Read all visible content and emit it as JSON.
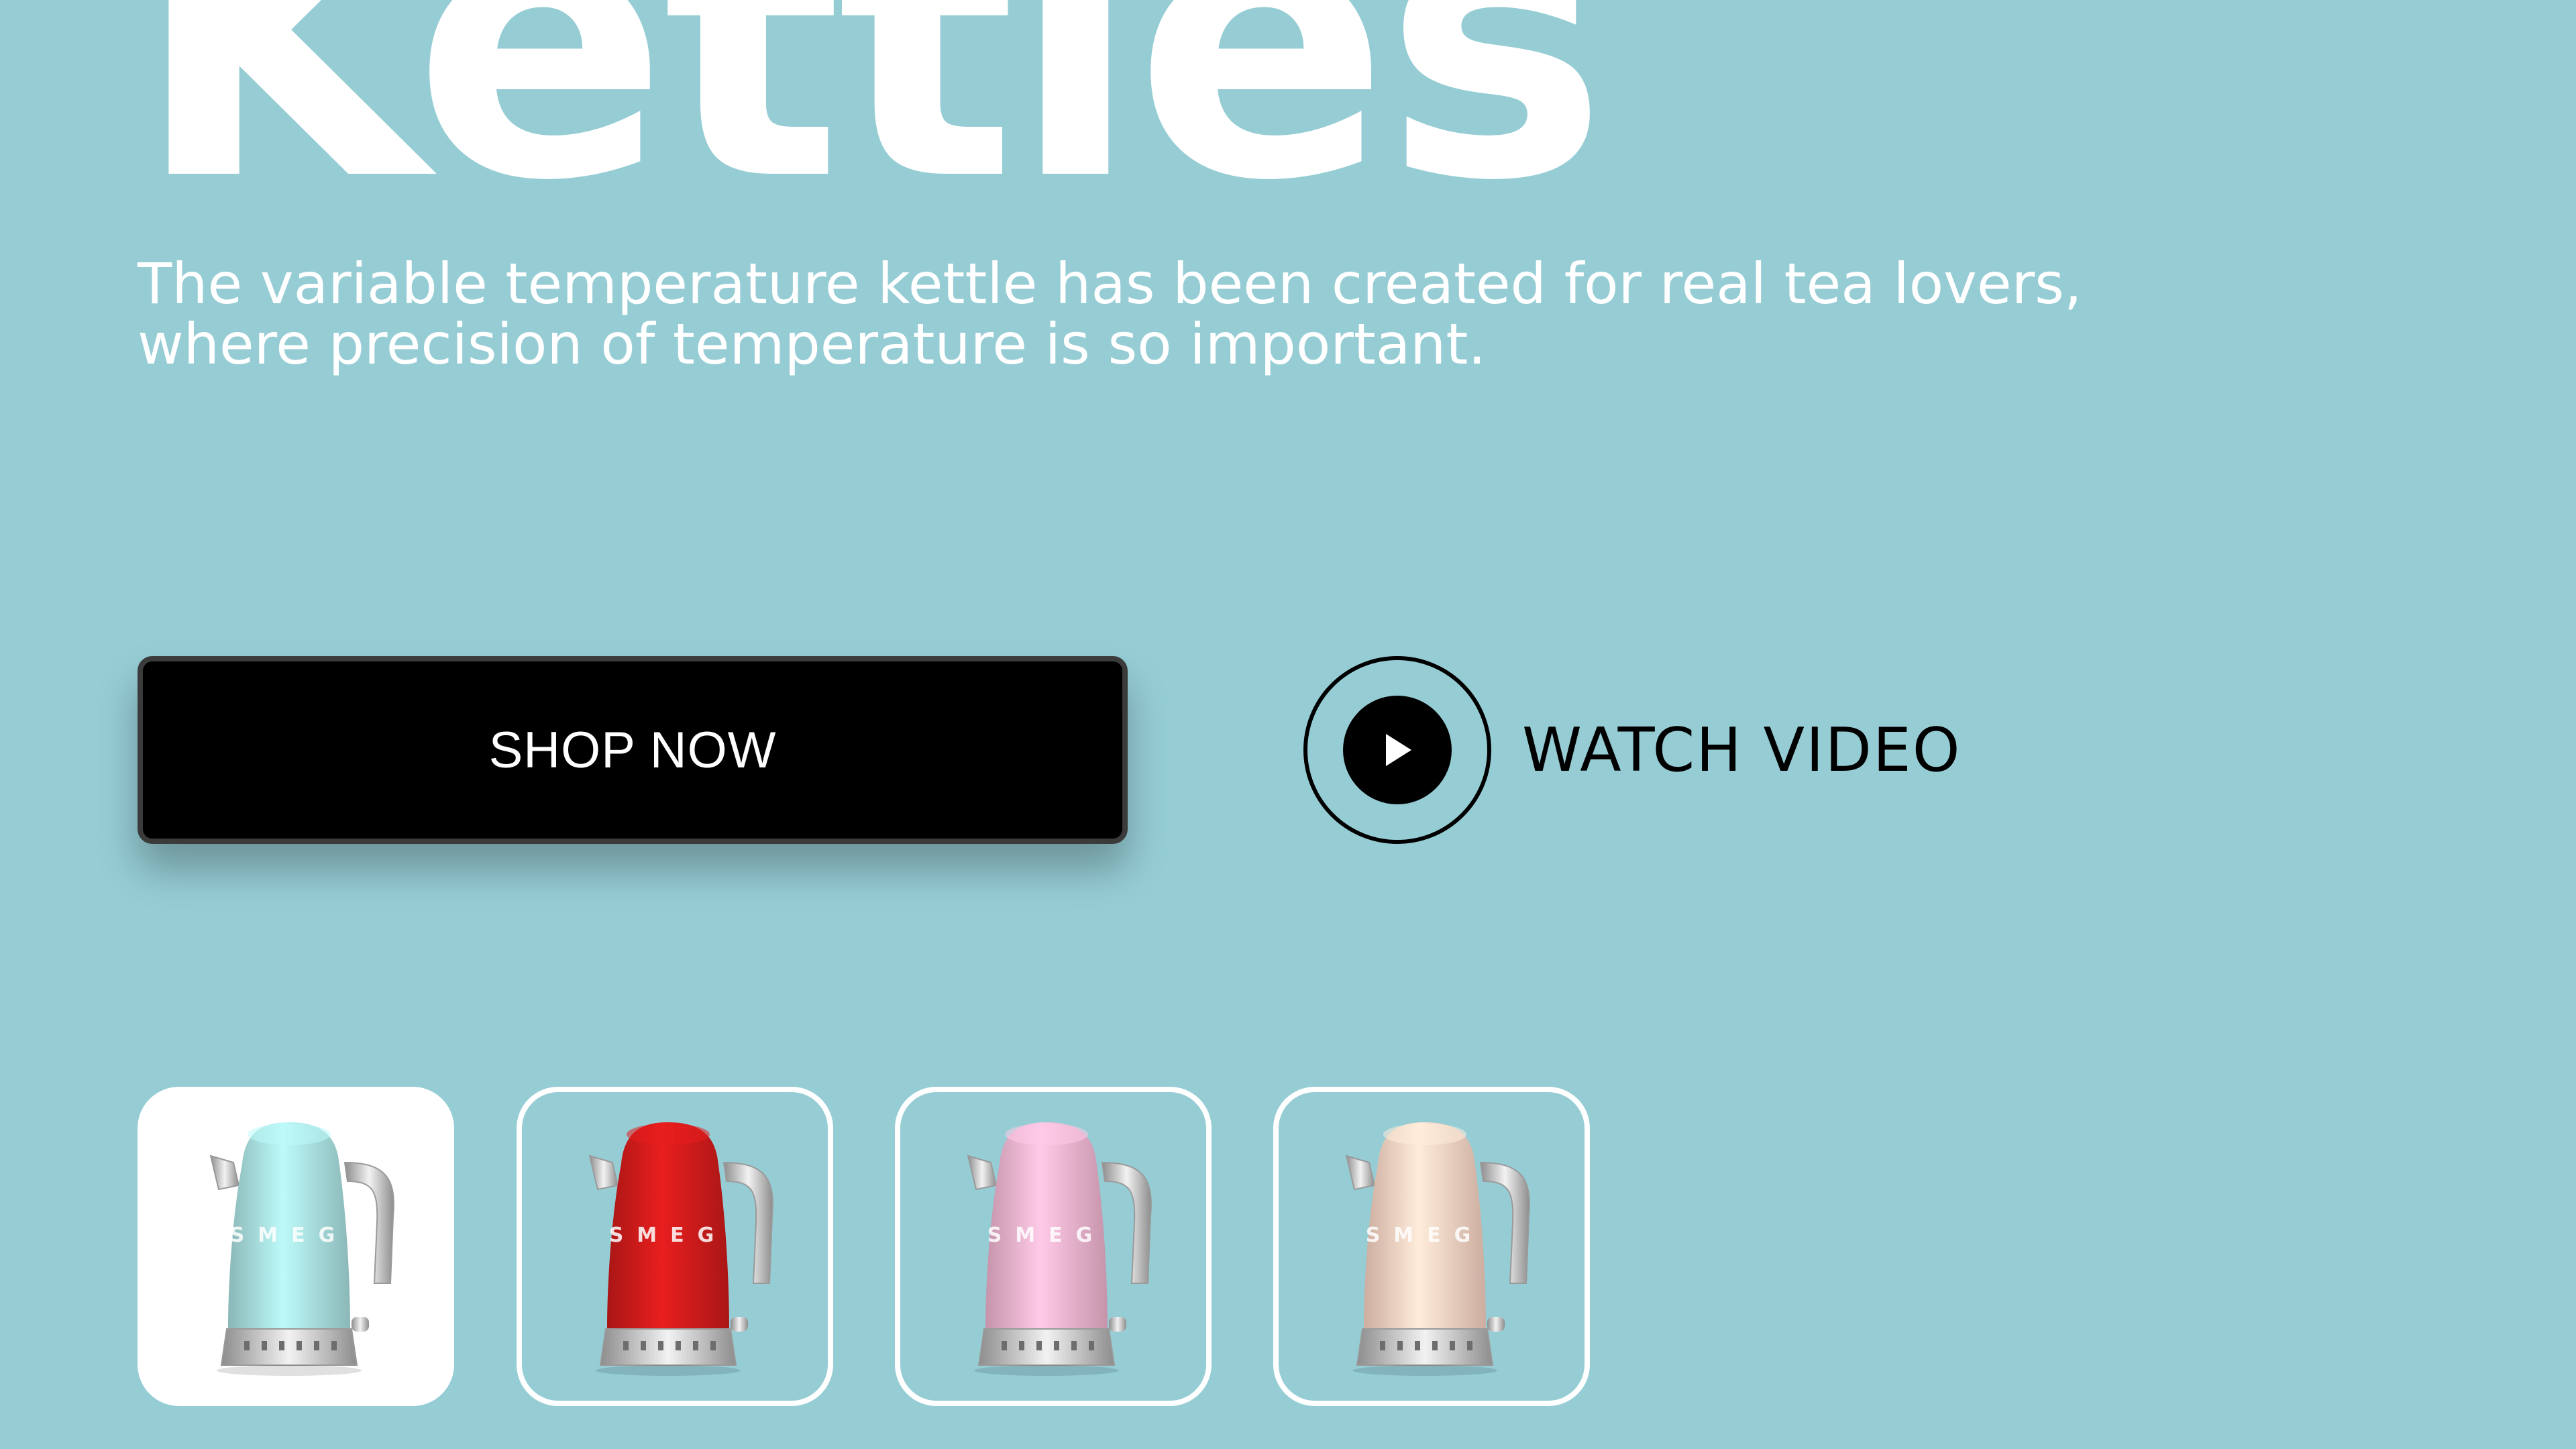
{
  "hero": {
    "title": "Kettles",
    "description_line1": "The variable temperature kettle has been created for real tea lovers,",
    "description_line2": "where precision of temperature is so important."
  },
  "actions": {
    "shop_label": "SHOP NOW",
    "watch_label": "WATCH VIDEO",
    "watch_icon": "play-icon"
  },
  "thumbnails": [
    {
      "name": "light blue kettle",
      "color": "#a9dfdf",
      "brand": "SMEG",
      "selected": true
    },
    {
      "name": "red kettle",
      "color": "#cf1b1b",
      "brand": "SMEG",
      "selected": false
    },
    {
      "name": "pink kettle",
      "color": "#f0b4cf",
      "brand": "SMEG",
      "selected": false
    },
    {
      "name": "cream kettle",
      "color": "#f9d3c3",
      "brand": "SMEG",
      "selected": false
    }
  ],
  "colors": {
    "background": "#96cdd5",
    "text_light": "#ffffff",
    "button_dark": "#000000"
  }
}
